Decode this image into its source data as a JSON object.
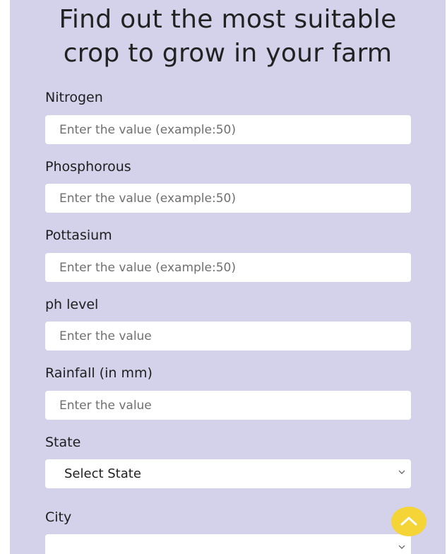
{
  "page": {
    "title_line1": "Find out the most suitable",
    "title_line2": "crop to grow in your farm"
  },
  "form": {
    "nitrogen": {
      "label": "Nitrogen",
      "placeholder": "Enter the value (example:50)"
    },
    "phosphorous": {
      "label": "Phosphorous",
      "placeholder": "Enter the value (example:50)"
    },
    "pottasium": {
      "label": "Pottasium",
      "placeholder": "Enter the value (example:50)"
    },
    "ph": {
      "label": "ph level",
      "placeholder": "Enter the value"
    },
    "rainfall": {
      "label": "Rainfall (in mm)",
      "placeholder": "Enter the value"
    },
    "state": {
      "label": "State",
      "selected": "Select State"
    },
    "city": {
      "label": "City",
      "selected": ""
    }
  },
  "colors": {
    "background": "#d3d2ea",
    "input_bg": "#ffffff",
    "scroll_button": "#f4d437"
  },
  "icons": {
    "dropdown": "chevron-down-icon",
    "scroll_top": "chevron-up-icon"
  }
}
